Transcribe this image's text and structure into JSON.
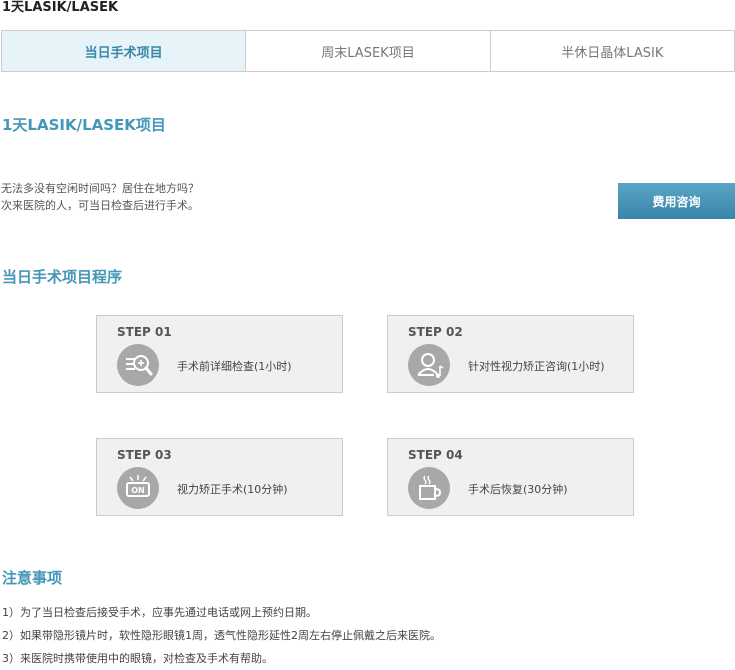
{
  "header": {
    "title": "1天LASIK/LASEK"
  },
  "tabs": [
    {
      "label": "当日手术项目",
      "active": true
    },
    {
      "label": "周末LASEK项目",
      "active": false
    },
    {
      "label": "半休日晶体LASIK",
      "active": false
    }
  ],
  "program": {
    "title": "1天LASIK/LASEK项目",
    "intro_lines": [
      "无法多没有空闲时间吗？居住在地方吗？",
      "次来医院的人，可当日检查后进行手术。"
    ],
    "consult_button": "费用咨询"
  },
  "procedure": {
    "title": "当日手术项目程序",
    "steps": [
      {
        "label": "STEP 01",
        "text": "手术前详细检查(1小时)",
        "icon": "magnifier-icon"
      },
      {
        "label": "STEP 02",
        "text": "针对性视力矫正咨询(1小时)",
        "icon": "consult-person-icon"
      },
      {
        "label": "STEP 03",
        "text": "视力矫正手术(10分钟)",
        "icon": "laser-on-icon"
      },
      {
        "label": "STEP 04",
        "text": "手术后恢复(30分钟)",
        "icon": "coffee-cup-icon"
      }
    ]
  },
  "notes": {
    "title": "注意事项",
    "items": [
      "1）为了当日检查后接受手术，应事先通过电话或网上预约日期。",
      "2）如果带隐形镜片时，软性隐形眼镜1周，透气性隐形延性2周左右停止佩戴之后来医院。",
      "3）来医院时携带使用中的眼镜，对检查及手术有帮助。"
    ]
  },
  "colors": {
    "accent": "#4597b7",
    "tab_active_bg": "#e6f3f9",
    "button_bg": "#3a86a8",
    "icon_bg": "#a8a8a8",
    "step_bg": "#f0f0f0"
  }
}
